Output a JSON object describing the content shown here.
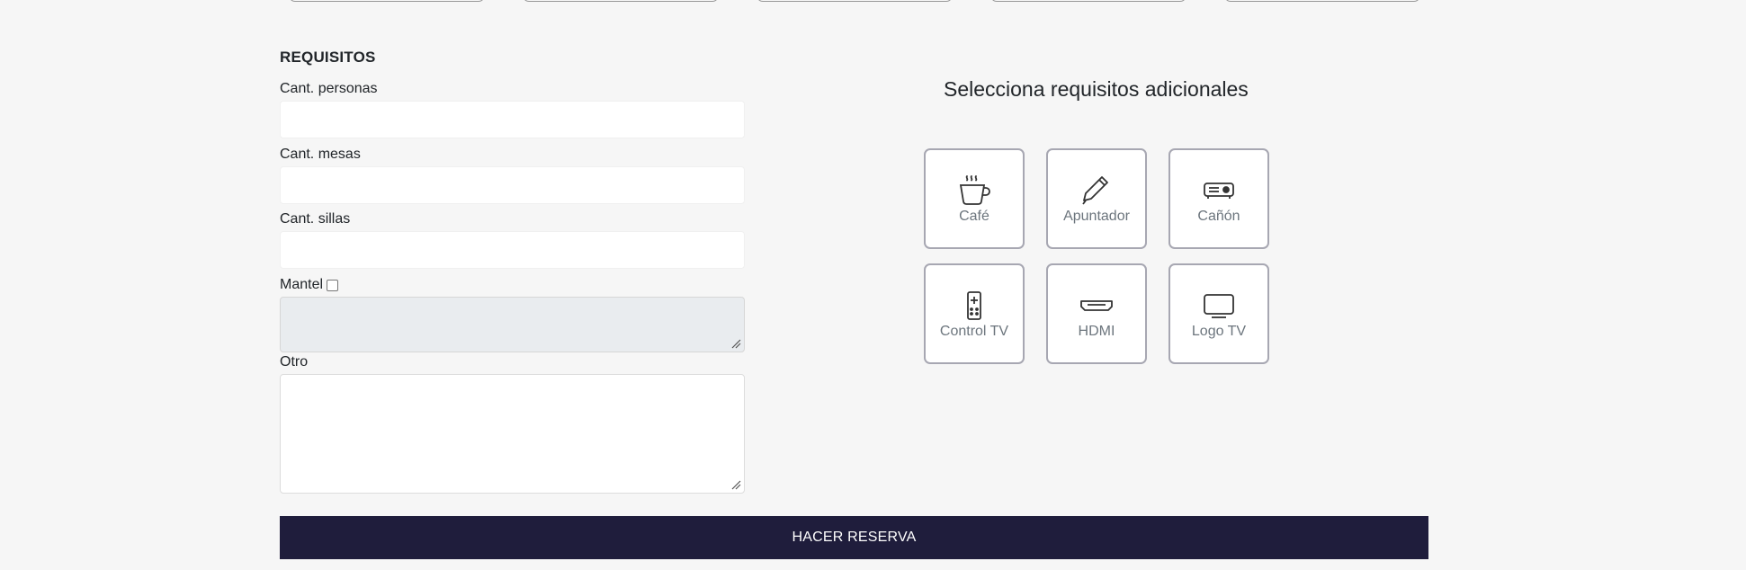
{
  "form": {
    "section_title": "REQUISITOS",
    "personas_label": "Cant. personas",
    "personas_value": "",
    "mesas_label": "Cant. mesas",
    "mesas_value": "",
    "sillas_label": "Cant. sillas",
    "sillas_value": "",
    "mantel_label": "Mantel",
    "mantel_checked": false,
    "otro_label": "Otro",
    "otro_value": ""
  },
  "extras": {
    "title": "Selecciona requisitos adicionales",
    "items": [
      {
        "label": "Café",
        "icon": "coffee-cup-icon"
      },
      {
        "label": "Apuntador",
        "icon": "pen-pointer-icon"
      },
      {
        "label": "Cañón",
        "icon": "projector-icon"
      },
      {
        "label": "Control TV",
        "icon": "remote-control-icon"
      },
      {
        "label": "HDMI",
        "icon": "hdmi-icon"
      },
      {
        "label": "Logo TV",
        "icon": "tv-icon"
      }
    ]
  },
  "actions": {
    "reserve_label": "HACER RESERVA"
  },
  "colors": {
    "background": "#f6f6f6",
    "button": "#1f1d3c",
    "tile_border": "#a7a7b2",
    "tile_label": "#6c757d"
  }
}
